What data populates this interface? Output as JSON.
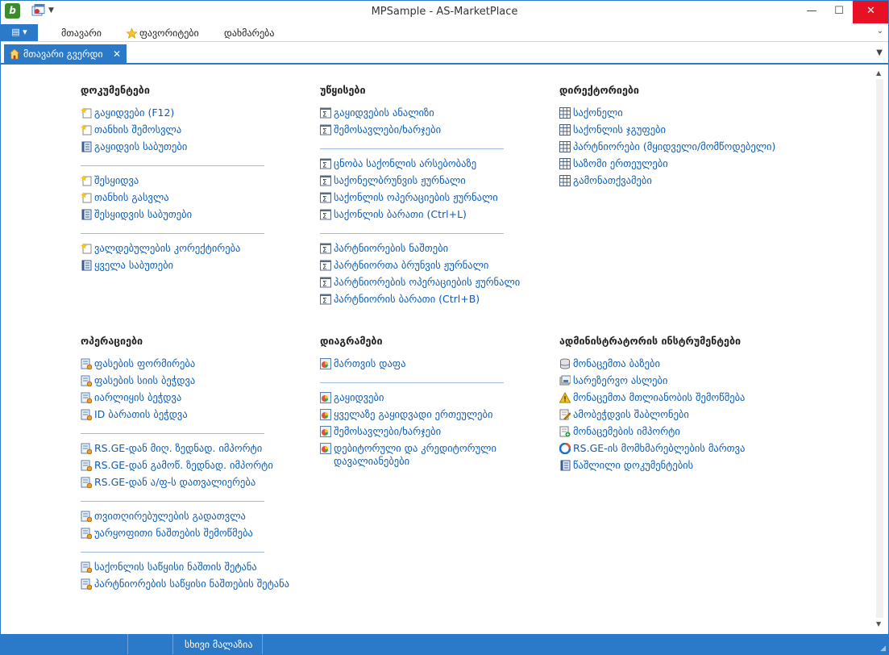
{
  "window": {
    "title": "MPSample - AS-MarketPlace",
    "min": "—",
    "max": "☐",
    "close": "✕"
  },
  "app_icon_letter": "b",
  "menu": {
    "file_glyph": "▤ ▾",
    "items": [
      "მთავარი",
      "ფავორიტები",
      "დახმარება"
    ],
    "collapse_glyph": "⌄"
  },
  "tab": {
    "label": "მთავარი გვერდი",
    "close": "✕",
    "overflow": "▼"
  },
  "colors": {
    "accent": "#2b79c9",
    "link": "#0e5db3"
  },
  "sections": {
    "documents": {
      "title": "დოკუმენტები",
      "groups": [
        [
          {
            "label": "გაყიდვები (F12)",
            "icon": "new-doc-icon"
          },
          {
            "label": "თანხის შემოსვლა",
            "icon": "new-doc-icon"
          },
          {
            "label": "გაყიდვის საბუთები",
            "icon": "journal-icon"
          }
        ],
        [
          {
            "label": "შესყიდვა",
            "icon": "new-doc-icon"
          },
          {
            "label": "თანხის გასვლა",
            "icon": "new-doc-icon"
          },
          {
            "label": "შესყიდვის საბუთები",
            "icon": "journal-icon"
          }
        ],
        [
          {
            "label": "ვალდებულების კორექტირება",
            "icon": "new-doc-icon"
          },
          {
            "label": "ყველა საბუთები",
            "icon": "journal-icon"
          }
        ]
      ]
    },
    "reports": {
      "title": "უწყისები",
      "groups": [
        [
          {
            "label": "გაყიდვების ანალიზი",
            "icon": "report-icon"
          },
          {
            "label": "შემოსავლები/ხარჯები",
            "icon": "report-icon"
          }
        ],
        [
          {
            "label": "ცნობა საქონლის არსებობაზე",
            "icon": "report-icon"
          },
          {
            "label": "საქონელბრუნვის ჟურნალი",
            "icon": "report-icon"
          },
          {
            "label": "საქონლის ოპერაციების ჟურნალი",
            "icon": "report-icon"
          },
          {
            "label": "საქონლის ბარათი (Ctrl+L)",
            "icon": "report-icon"
          }
        ],
        [
          {
            "label": "პარტნიორების ნაშთები",
            "icon": "report-icon"
          },
          {
            "label": "პარტნიორთა ბრუნვის ჟურნალი",
            "icon": "report-icon"
          },
          {
            "label": "პარტნიორების ოპერაციების ჟურნალი",
            "icon": "report-icon"
          },
          {
            "label": "პარტნიორის ბარათი (Ctrl+B)",
            "icon": "report-icon"
          }
        ]
      ]
    },
    "directories": {
      "title": "დირექტორიები",
      "groups": [
        [
          {
            "label": "საქონელი",
            "icon": "grid-icon"
          },
          {
            "label": "საქონლის ჯგუფები",
            "icon": "grid-icon"
          },
          {
            "label": "პარტნიორები (მყიდველი/მომწოდებელი)",
            "icon": "grid-icon"
          },
          {
            "label": "საზომი ერთეულები",
            "icon": "grid-icon"
          },
          {
            "label": "გამონათქვამები",
            "icon": "grid-icon"
          }
        ]
      ]
    },
    "operations": {
      "title": "ოპერაციები",
      "groups": [
        [
          {
            "label": "ფასების ფორმირება",
            "icon": "op-icon"
          },
          {
            "label": "ფასების სიის ბეჭდვა",
            "icon": "op-icon"
          },
          {
            "label": "იარლიყის ბეჭდვა",
            "icon": "op-icon"
          },
          {
            "label": "ID ბარათის ბეჭდვა",
            "icon": "op-icon"
          }
        ],
        [
          {
            "label": "RS.GE-დან მიღ. ზედნად. იმპორტი",
            "icon": "op-icon"
          },
          {
            "label": "RS.GE-დან გამოწ. ზედნად. იმპორტი",
            "icon": "op-icon"
          },
          {
            "label": "RS.GE-დან ა/ფ-ს დათვალიერება",
            "icon": "op-icon"
          }
        ],
        [
          {
            "label": "თვითღირებულების გადათვლა",
            "icon": "op-icon"
          },
          {
            "label": "უარყოფითი ნაშთების შემოწმება",
            "icon": "op-icon"
          }
        ],
        [
          {
            "label": "საქონლის საწყისი ნაშთის შეტანა",
            "icon": "op-icon"
          },
          {
            "label": "პარტნიორების საწყისი ნაშთების შეტანა",
            "icon": "op-icon"
          }
        ]
      ]
    },
    "diagrams": {
      "title": "დიაგრამები",
      "groups": [
        [
          {
            "label": "მართვის დაფა",
            "icon": "chart-icon"
          }
        ],
        [
          {
            "label": "გაყიდვები",
            "icon": "chart-icon"
          },
          {
            "label": "ყველაზე გაყიდვადი ერთეულები",
            "icon": "chart-icon"
          },
          {
            "label": "შემოსავლები/ხარჯები",
            "icon": "chart-icon"
          },
          {
            "label": "დებიტორული და კრედიტორული დავალიანებები",
            "icon": "chart-icon",
            "multi": true
          }
        ]
      ]
    },
    "admin": {
      "title": "ადმინისტრატორის ინსტრუმენტები",
      "groups": [
        [
          {
            "label": "მონაცემთა ბაზები",
            "icon": "database-icon"
          },
          {
            "label": "სარეზერვო ასლები",
            "icon": "backup-icon"
          },
          {
            "label": "მონაცემთა მთლიანობის შემოწმება",
            "icon": "warning-icon"
          },
          {
            "label": "ამობეჭდვის შაბლონები",
            "icon": "template-icon"
          },
          {
            "label": "მონაცემების იმპორტი",
            "icon": "import-icon"
          },
          {
            "label": "RS.GE-ის მომხმარებლების მართვა",
            "icon": "rsge-icon"
          },
          {
            "label": "წაშლილი დოკუმენტების",
            "icon": "journal-icon"
          }
        ]
      ]
    }
  },
  "status": {
    "text": "სხივი მალაზია",
    "grip": "◢"
  }
}
